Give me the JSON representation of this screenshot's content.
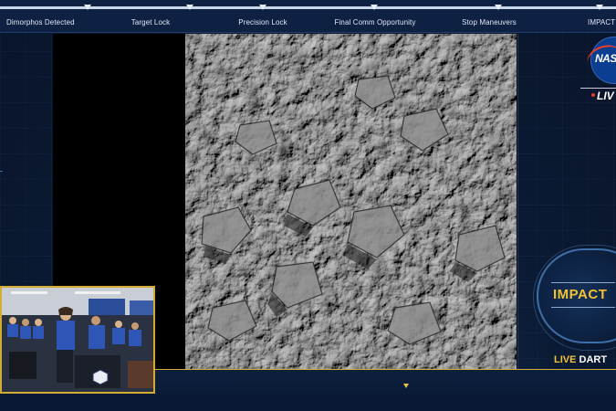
{
  "timeline": {
    "milestones": [
      {
        "label": "Dimorphos Detected"
      },
      {
        "label": "Target Lock"
      },
      {
        "label": "Precision Lock"
      },
      {
        "label": "Final Comm Opportunity"
      },
      {
        "label": "Stop Maneuvers"
      },
      {
        "label": "IMPACT"
      }
    ]
  },
  "branding": {
    "nasa_logo_text": "NASA",
    "live_tag": "LIV"
  },
  "impact_badge": {
    "label": "IMPACT"
  },
  "footer": {
    "live_word": "LIVE",
    "mission_word": "DART"
  },
  "colors": {
    "accent_gold": "#f2c230",
    "background_navy": "#0b1a33",
    "nasa_blue": "#0b3d91",
    "live_red": "#e03a2a"
  },
  "icons": {
    "nasa_logo": "nasa-meatball-icon",
    "timeline_marker": "triangle-down-icon",
    "live_dot": "red-dot-icon"
  }
}
